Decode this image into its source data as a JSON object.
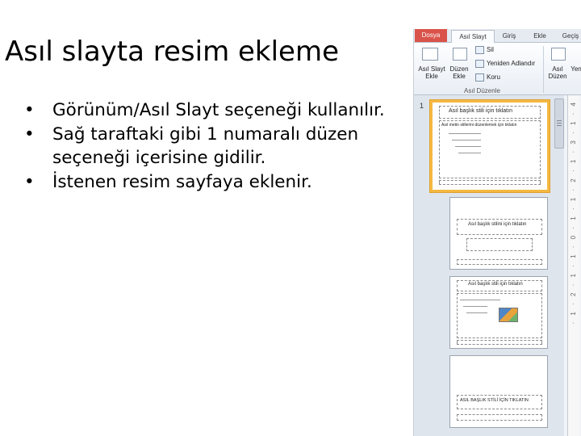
{
  "slide": {
    "title": "Asıl slayta resim ekleme",
    "bullets": [
      {
        "marker": "•",
        "text": "Görünüm/Asıl Slayt seçeneği kullanılır."
      },
      {
        "marker": "•",
        "text": "Sağ taraftaki gibi 1 numaralı düzen seçeneği içerisine gidilir."
      },
      {
        "marker": "•",
        "text": "İstenen resim sayfaya eklenir."
      }
    ]
  },
  "ribbon": {
    "tabs": {
      "dosya": "Dosya",
      "asil_slayt": "Asıl Slayt",
      "giris": "Giriş",
      "ekle": "Ekle",
      "gecis": "Geçiş"
    },
    "buttons": {
      "asil_slayt_ekle": "Asıl Slayt Ekle",
      "duzen_ekle": "Düzen Ekle",
      "sil": "Sil",
      "yeniden_adlandir": "Yeniden Adlandır",
      "koru": "Koru",
      "asil_duzen": "Asıl Düzen",
      "yen": "Yen"
    },
    "group_label": "Asıl Düzenle"
  },
  "thumbnails": {
    "selected_number": "1",
    "t1_title": "Asıl başlık stili için tıklatın",
    "t1_body": "Asıl metin stillerini düzenlemek için tıklatın",
    "t2_title": "Asıl başlık stilini için tıklatın",
    "t3_title": "Asıl başlık stili için tıklatın",
    "t4_title": "ASIL BAŞLIK STİLİ İÇİN TIKLATIN"
  },
  "ruler": {
    "marks": "· 1 · 2 · 1 · 1 · 0 · 1 · 1 · 2 · 1 · 3 · 1 · 4"
  },
  "colors": {
    "file_tab": "#d9534a",
    "selected_thumb_border": "#f4b942"
  }
}
